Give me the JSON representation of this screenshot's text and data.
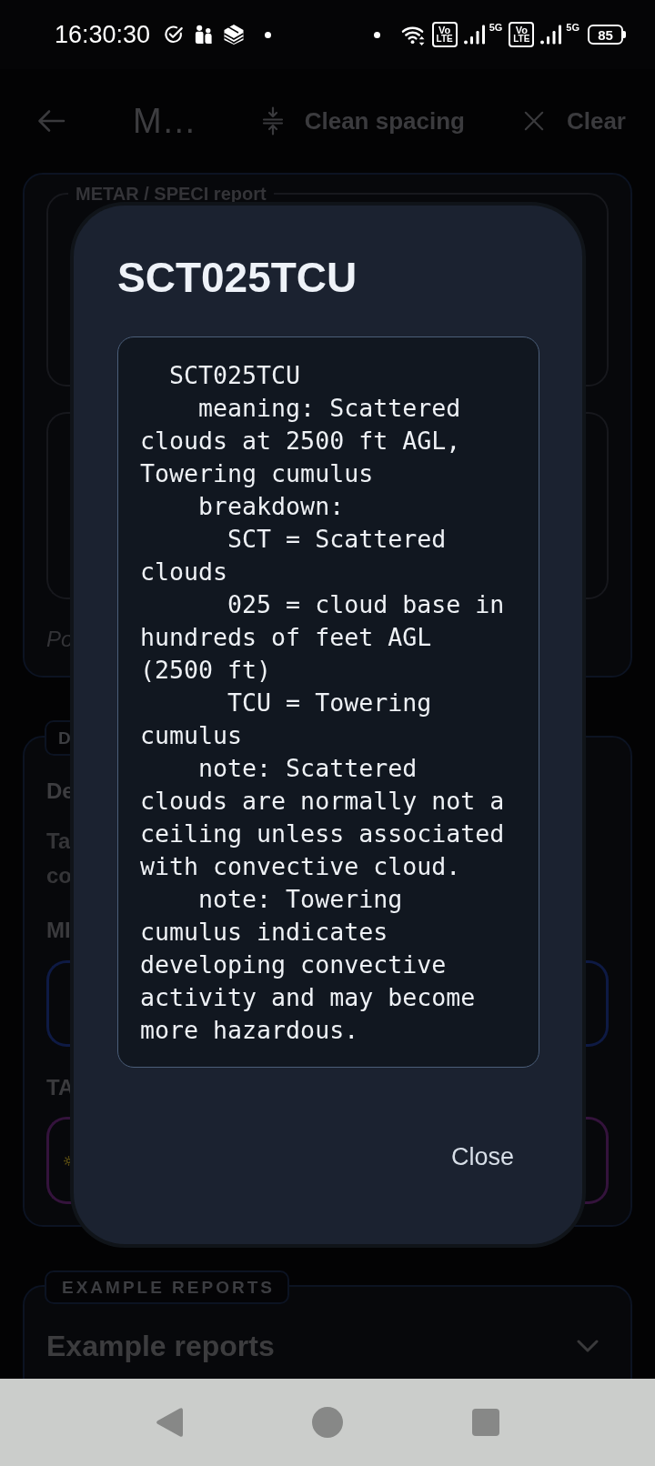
{
  "status_bar": {
    "time": "16:30:30",
    "sims": [
      {
        "volte": [
          "Vo",
          "LTE"
        ],
        "network": "5G"
      },
      {
        "volte": [
          "Vo",
          "LTE"
        ],
        "network": "5G"
      }
    ],
    "battery": "85"
  },
  "app_bar": {
    "title": "M…",
    "actions": [
      {
        "kind": "clean_spacing",
        "label": "Clean spacing"
      },
      {
        "kind": "clear",
        "label": "Clear"
      }
    ]
  },
  "report_card": {
    "field_label": "METAR / SPECI report",
    "hint": "Po"
  },
  "decode_card": {
    "badge": "D",
    "title": "De",
    "description": [
      "Ta",
      "co"
    ],
    "inputs": [
      {
        "label": "MI",
        "color": "#0e1a44"
      },
      {
        "label": "TA",
        "color": "#34133c"
      }
    ]
  },
  "examples_card": {
    "badge": "EXAMPLE REPORTS",
    "title": "Example reports",
    "expanded": false
  },
  "dialog": {
    "title": "SCT025TCU",
    "text": "  SCT025TCU\n    meaning: Scattered clouds at 2500 ft AGL, Towering cumulus\n    breakdown:\n      SCT = Scattered clouds\n      025 = cloud base in hundreds of feet AGL (2500 ft)\n      TCU = Towering cumulus\n    note: Scattered clouds are normally not a ceiling unless associated with convective cloud.\n    note: Towering cumulus indicates developing convective activity and may become more hazardous.",
    "close": "Close"
  }
}
